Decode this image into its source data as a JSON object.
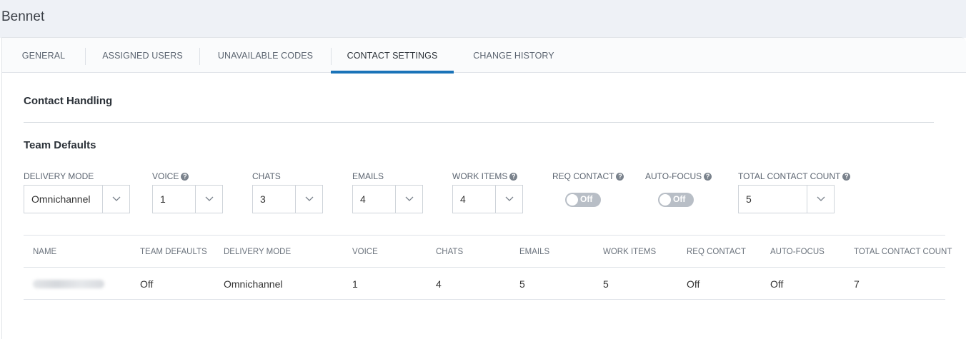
{
  "page": {
    "title": "Bennet"
  },
  "tabs": [
    {
      "label": "GENERAL"
    },
    {
      "label": "ASSIGNED USERS"
    },
    {
      "label": "UNAVAILABLE CODES"
    },
    {
      "label": "CONTACT SETTINGS",
      "active": true
    },
    {
      "label": "CHANGE HISTORY"
    }
  ],
  "contact_handling": {
    "title": "Contact Handling"
  },
  "team_defaults": {
    "title": "Team Defaults",
    "delivery_mode": {
      "label": "DELIVERY MODE",
      "value": "Omnichannel"
    },
    "voice": {
      "label": "VOICE",
      "value": "1"
    },
    "chats": {
      "label": "CHATS",
      "value": "3"
    },
    "emails": {
      "label": "EMAILS",
      "value": "4"
    },
    "work_items": {
      "label": "WORK ITEMS",
      "value": "4"
    },
    "req_contact": {
      "label": "REQ CONTACT",
      "state": "Off"
    },
    "auto_focus": {
      "label": "AUTO-FOCUS",
      "state": "Off"
    },
    "total_contact_count": {
      "label": "TOTAL CONTACT COUNT",
      "value": "5"
    },
    "help_glyph": "?"
  },
  "table": {
    "columns": [
      "NAME",
      "TEAM DEFAULTS",
      "DELIVERY MODE",
      "VOICE",
      "CHATS",
      "EMAILS",
      "WORK ITEMS",
      "REQ CONTACT",
      "AUTO-FOCUS",
      "TOTAL CONTACT COUNT"
    ],
    "rows": [
      {
        "team_defaults": "Off",
        "delivery_mode": "Omnichannel",
        "voice": "1",
        "chats": "4",
        "emails": "5",
        "work_items": "5",
        "req_contact": "Off",
        "auto_focus": "Off",
        "total_contact_count": "7"
      }
    ]
  },
  "colors": {
    "accent": "#1a73b8",
    "toggle_off": "#b8bec6",
    "header_bg": "#eef1f6"
  }
}
